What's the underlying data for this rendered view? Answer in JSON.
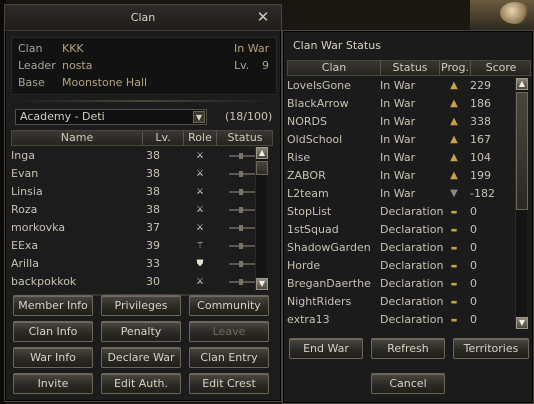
{
  "clan_window": {
    "title": "Clan",
    "info": {
      "clan_label": "Clan",
      "clan_value": "KKK",
      "leader_label": "Leader",
      "leader_value": "nosta",
      "base_label": "Base",
      "base_value": "Moonstone Hall",
      "war_status": "In War",
      "level_label": "Lv.",
      "level_value": "9"
    },
    "subunit": {
      "selected": "Academy - Deti",
      "count": "(18/100)"
    },
    "columns": [
      "Name",
      "Lv.",
      "Role",
      "Status"
    ],
    "members": [
      {
        "name": "Inga",
        "level": "38",
        "role_icon": "crossed-swords-icon"
      },
      {
        "name": "Evan",
        "level": "38",
        "role_icon": "crossed-swords-icon"
      },
      {
        "name": "Linsia",
        "level": "38",
        "role_icon": "crossed-swords-icon"
      },
      {
        "name": "Roza",
        "level": "38",
        "role_icon": "crossed-swords-icon"
      },
      {
        "name": "morkovka",
        "level": "37",
        "role_icon": "crossed-swords-icon"
      },
      {
        "name": "EExa",
        "level": "39",
        "role_icon": "staff-icon"
      },
      {
        "name": "Arilla",
        "level": "33",
        "role_icon": "shield-icon"
      },
      {
        "name": "backpokkok",
        "level": "30",
        "role_icon": "crossed-swords-icon"
      }
    ],
    "buttons": [
      [
        "Member Info",
        "Privileges",
        "Community"
      ],
      [
        "Clan Info",
        "Penalty",
        "Leave"
      ],
      [
        "War Info",
        "Declare War",
        "Clan Entry"
      ],
      [
        "Invite",
        "Edit Auth.",
        "Edit Crest"
      ]
    ]
  },
  "war_window": {
    "title": "Clan War Status",
    "columns": [
      "Clan",
      "Status",
      "Prog.",
      "Score"
    ],
    "rows": [
      {
        "clan": "LoveIsGone",
        "status": "In War",
        "prog": "up-arrow-icon",
        "score": "229"
      },
      {
        "clan": "BlackArrow",
        "status": "In War",
        "prog": "up-arrow-icon",
        "score": "186"
      },
      {
        "clan": "NORDS",
        "status": "In War",
        "prog": "up-arrow-icon",
        "score": "338"
      },
      {
        "clan": "OldSchool",
        "status": "In War",
        "prog": "up-arrow-icon",
        "score": "167"
      },
      {
        "clan": "Rise",
        "status": "In War",
        "prog": "up-arrow-icon",
        "score": "104"
      },
      {
        "clan": "ZABOR",
        "status": "In War",
        "prog": "up-arrow-icon",
        "score": "199"
      },
      {
        "clan": "L2team",
        "status": "In War",
        "prog": "down-arrow-icon",
        "score": "-182"
      },
      {
        "clan": "StopList",
        "status": "Declaration",
        "prog": "dash-icon",
        "score": "0"
      },
      {
        "clan": "1stSquad",
        "status": "Declaration",
        "prog": "dash-icon",
        "score": "0"
      },
      {
        "clan": "ShadowGarden",
        "status": "Declaration",
        "prog": "dash-icon",
        "score": "0"
      },
      {
        "clan": "Horde",
        "status": "Declaration",
        "prog": "dash-icon",
        "score": "0"
      },
      {
        "clan": "BreganDaerthe",
        "status": "Declaration",
        "prog": "dash-icon",
        "score": "0"
      },
      {
        "clan": "NightRiders",
        "status": "Declaration",
        "prog": "dash-icon",
        "score": "0"
      },
      {
        "clan": "extra13",
        "status": "Declaration",
        "prog": "dash-icon",
        "score": "0"
      }
    ],
    "buttons": [
      "End War",
      "Refresh",
      "Territories"
    ],
    "cancel": "Cancel"
  },
  "colors": {
    "gold_text": "#b3a47c",
    "up_arrow": "#c8a24a",
    "down_arrow": "#8a8a8a"
  }
}
